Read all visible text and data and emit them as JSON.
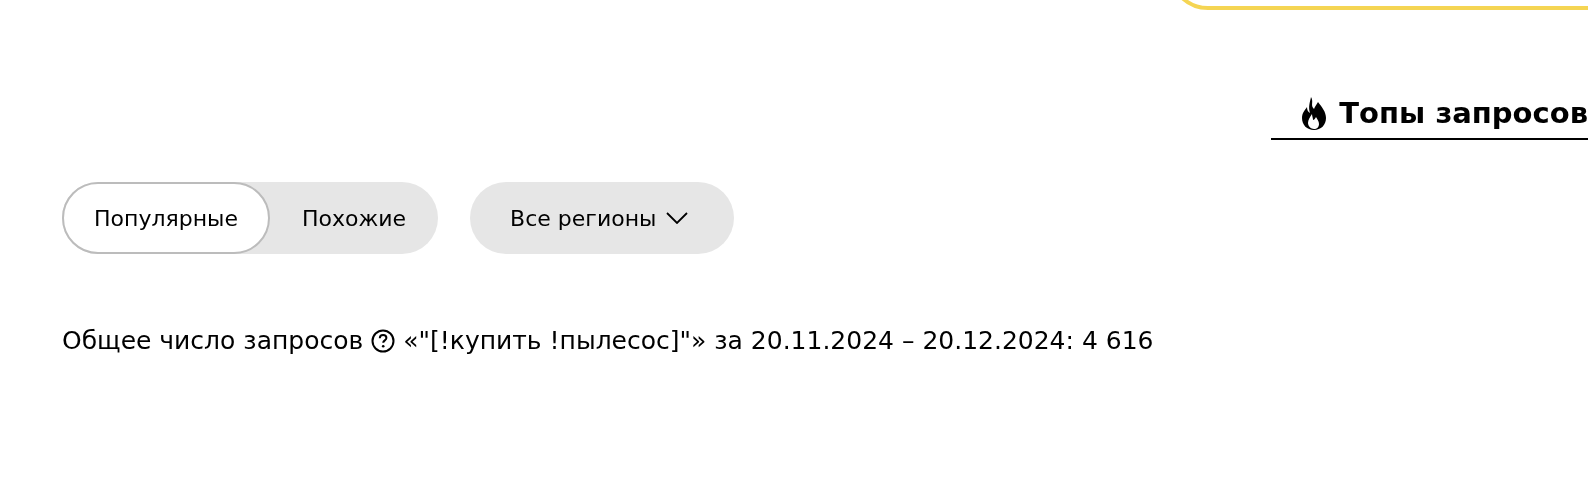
{
  "top_tab": {
    "label": "Топы запросов",
    "selected": true
  },
  "mode_tabs": [
    {
      "label": "Популярные",
      "selected": true
    },
    {
      "label": "Похожие",
      "selected": false
    }
  ],
  "region_dropdown": {
    "value": "Все регионы"
  },
  "summary": {
    "label": "Общее число запросов",
    "text": "«\"[!купить !пылесос]\"» за 20.11.2024 – 20.12.2024: 4 616"
  }
}
